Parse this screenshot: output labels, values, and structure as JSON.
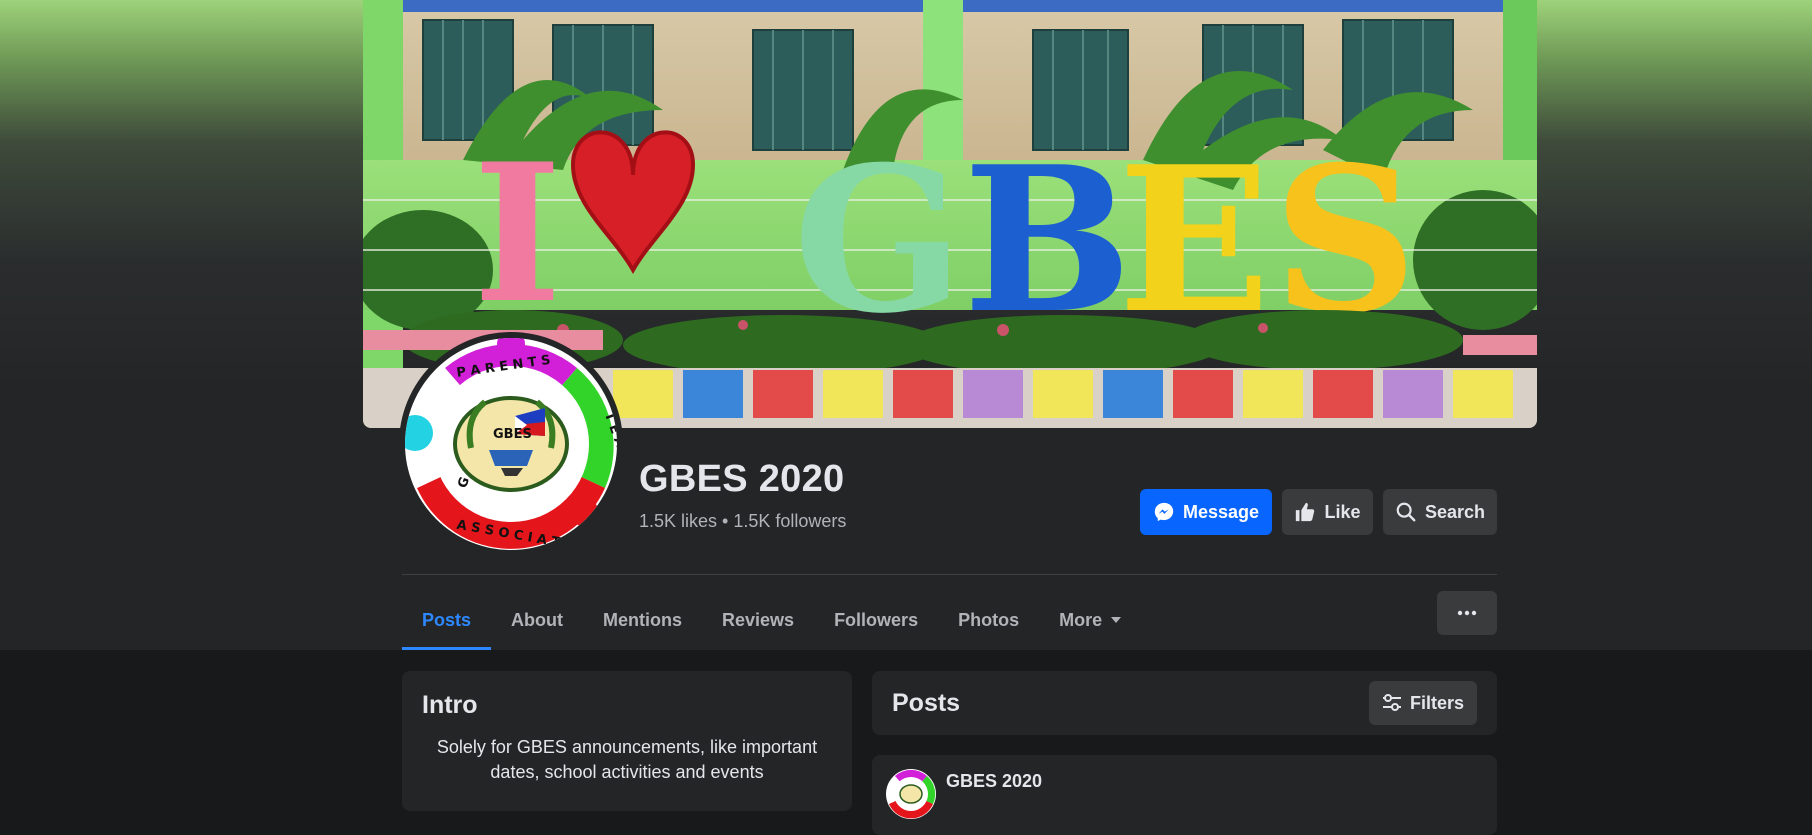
{
  "page": {
    "name": "GBES 2020",
    "likes": "1.5K likes",
    "separator": "•",
    "followers": "1.5K followers"
  },
  "cover": {
    "letters": [
      "I",
      "G",
      "B",
      "E",
      "S"
    ]
  },
  "logo": {
    "ring_text_top": "PARENTS",
    "ring_text_left": "GENERAL",
    "ring_text_right": "TEACHERS",
    "ring_text_bottom": "ASSOCIATION",
    "center_text": "GBES"
  },
  "actions": {
    "message": "Message",
    "like": "Like",
    "search": "Search"
  },
  "tabs": [
    {
      "label": "Posts",
      "active": true
    },
    {
      "label": "About"
    },
    {
      "label": "Mentions"
    },
    {
      "label": "Reviews"
    },
    {
      "label": "Followers"
    },
    {
      "label": "Photos"
    },
    {
      "label": "More"
    }
  ],
  "intro": {
    "title": "Intro",
    "text": "Solely for GBES announcements, like important dates, school activities and events"
  },
  "posts": {
    "title": "Posts",
    "filters": "Filters",
    "first_post_author": "GBES 2020"
  },
  "colors": {
    "accent": "#0866ff",
    "tab_active": "#2d88ff",
    "background": "#18191a",
    "card": "#242526",
    "button": "#3a3b3c"
  },
  "icons": {
    "message": "messenger-icon",
    "like": "thumbs-up-icon",
    "search": "search-icon",
    "more": "caret-down-icon",
    "menu": "ellipsis-icon",
    "filters": "sliders-icon"
  }
}
